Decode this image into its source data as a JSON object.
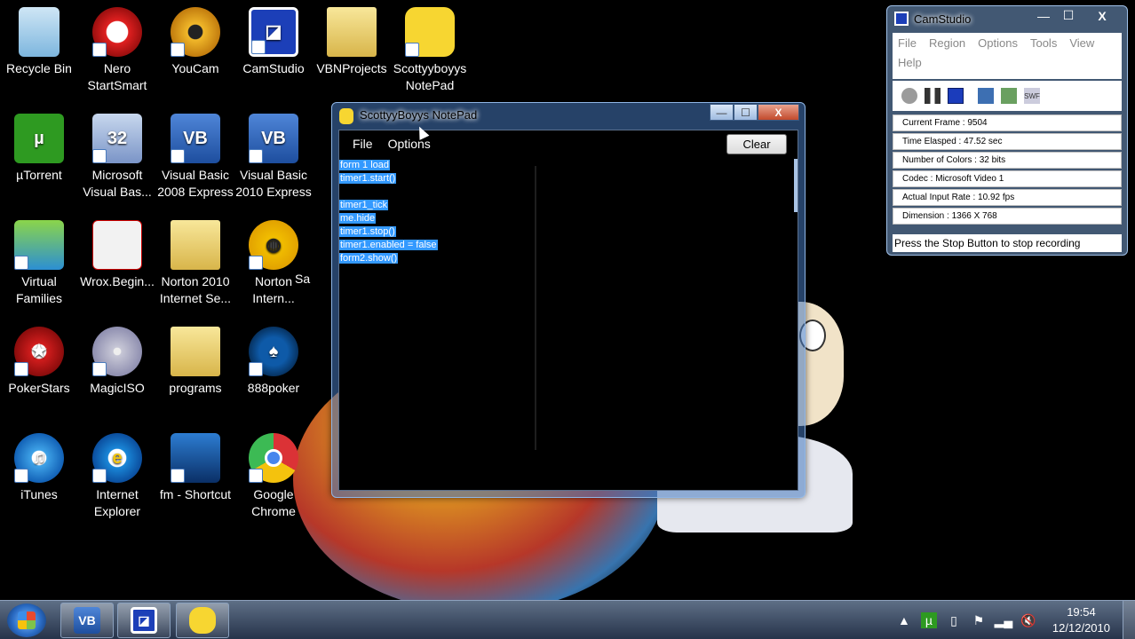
{
  "desktop": {
    "icons": [
      {
        "label": "Recycle Bin",
        "icon": "recycle-bin-icon"
      },
      {
        "label": "Nero StartSmart",
        "icon": "nero-icon"
      },
      {
        "label": "YouCam",
        "icon": "youcam-icon"
      },
      {
        "label": "CamStudio",
        "icon": "camstudio-icon"
      },
      {
        "label": "VBNProjects",
        "icon": "folder-icon"
      },
      {
        "label": "Scottyyboyys NotePad",
        "icon": "notepad-icon"
      },
      {
        "label": "µTorrent",
        "icon": "utorrent-icon"
      },
      {
        "label": "Microsoft Visual Bas...",
        "icon": "visual-basic-6-icon"
      },
      {
        "label": "Visual Basic 2008 Express",
        "icon": "vb2008-icon"
      },
      {
        "label": "Visual Basic 2010 Express",
        "icon": "vb2010-icon"
      },
      {
        "label": "Virtual Families",
        "icon": "virtual-families-icon"
      },
      {
        "label": "Wrox.Begin...",
        "icon": "pdf-icon"
      },
      {
        "label": "Norton 2010 Internet Se...",
        "icon": "folder-icon"
      },
      {
        "label": "Norton Intern...",
        "icon": "norton-icon"
      },
      {
        "label": "PokerStars",
        "icon": "pokerstars-icon"
      },
      {
        "label": "MagicISO",
        "icon": "magiciso-icon"
      },
      {
        "label": "programs",
        "icon": "folder-icon"
      },
      {
        "label": "888poker",
        "icon": "888poker-icon"
      },
      {
        "label": "iTunes",
        "icon": "itunes-icon"
      },
      {
        "label": "Internet Explorer",
        "icon": "internet-explorer-icon"
      },
      {
        "label": "fm - Shortcut",
        "icon": "football-manager-icon"
      },
      {
        "label": "Google Chrome",
        "icon": "chrome-icon"
      }
    ],
    "partial_icon_label": "Sa"
  },
  "notepad": {
    "title": "ScottyyBoyys NotePad",
    "menu": [
      "File",
      "Options"
    ],
    "clear_label": "Clear",
    "lines": [
      "form 1 load",
      "timer1.start()",
      "",
      "timer1_tick",
      "me.hide",
      "timer1.stop()",
      "timer1.enabled = false",
      "form2.show()"
    ],
    "min_glyph": "—",
    "max_glyph": "☐",
    "close_glyph": "X"
  },
  "camstudio": {
    "title": "CamStudio",
    "menu_row1": [
      "File",
      "Region",
      "Options",
      "Tools",
      "View"
    ],
    "menu_row2": [
      "Help"
    ],
    "toolbar_label_swf": "SWF",
    "stats": [
      "Current Frame : 9504",
      "Time Elasped : 47.52 sec",
      "Number of Colors : 32 bits",
      "Codec : Microsoft Video 1",
      "Actual Input Rate : 10.92 fps",
      "Dimension : 1366 X 768"
    ],
    "status": "Press the Stop Button to stop recording",
    "min_glyph": "—",
    "max_glyph": "☐",
    "close_glyph": "X"
  },
  "taskbar": {
    "apps": [
      "visual-basic",
      "camstudio",
      "notepad"
    ],
    "time": "19:54",
    "date": "12/12/2010"
  },
  "colors": {
    "selection": "#3399ff",
    "taskbar": "#26334a",
    "window_glass": "#4678be"
  }
}
